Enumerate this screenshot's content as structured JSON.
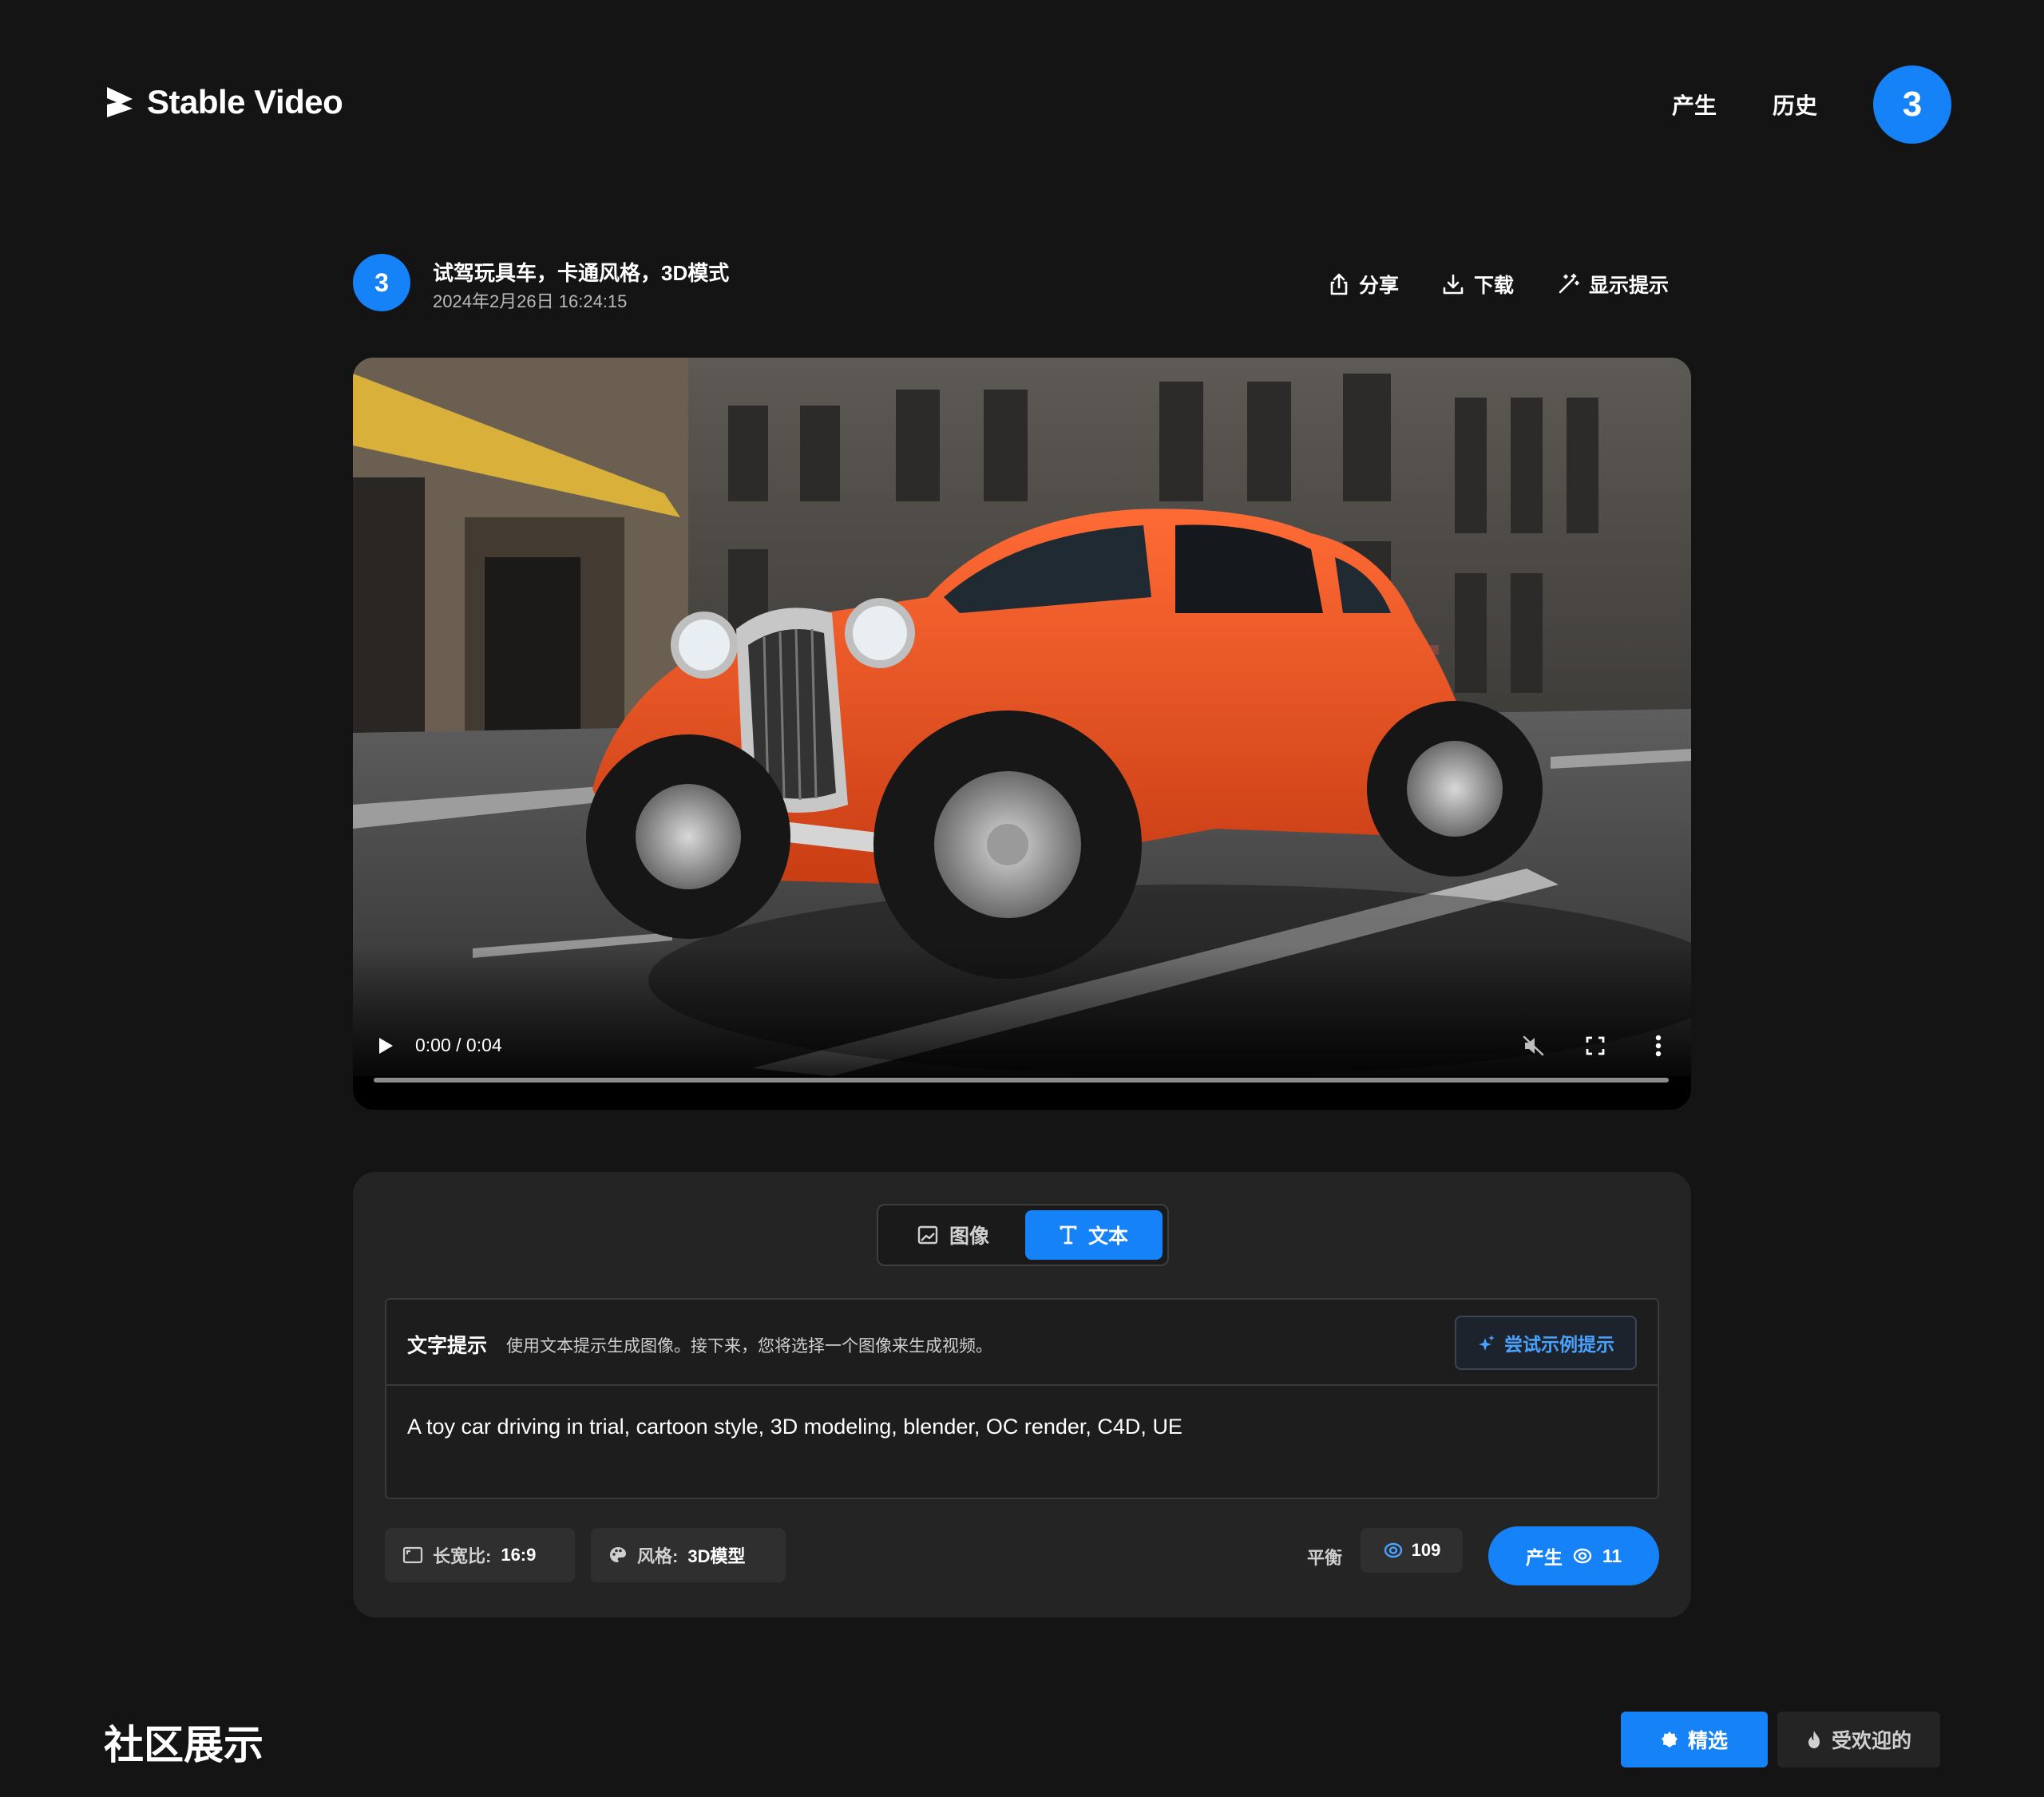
{
  "app": {
    "title": "Stable Video",
    "nav": {
      "generate": "产生",
      "history": "历史",
      "credits": "3"
    }
  },
  "video_info": {
    "avatar_text": "3",
    "title": "试驾玩具车，卡通风格，3D模式",
    "date": "2024年2月26日 16:24:15",
    "actions": {
      "share": "分享",
      "download": "下载",
      "show_prompt": "显示提示"
    }
  },
  "player": {
    "time": "0:00 / 0:04",
    "progress": 0,
    "muted": true
  },
  "prompt_panel": {
    "tabs": {
      "image": "图像",
      "text": "文本",
      "active": "text"
    },
    "label": "文字提示",
    "description": "使用文本提示生成图像。接下来，您将选择一个图像来生成视频。",
    "try_example": "尝试示例提示",
    "prompt_text": "A toy car driving in trial, cartoon style, 3D modeling, blender, OC render, C4D, UE",
    "aspect_ratio": {
      "label": "长宽比:",
      "value": "16:9"
    },
    "style": {
      "label": "风格:",
      "value": "3D模型"
    },
    "balance": {
      "label": "平衡",
      "value": "109"
    },
    "generate": {
      "label": "产生",
      "cost": "11"
    }
  },
  "community": {
    "title": "社区展示",
    "filters": {
      "featured": "精选",
      "popular": "受欢迎的",
      "active": "featured"
    }
  },
  "colors": {
    "accent": "#1582f8",
    "background": "#141414",
    "panel": "#242424",
    "car": "#e8501f"
  }
}
